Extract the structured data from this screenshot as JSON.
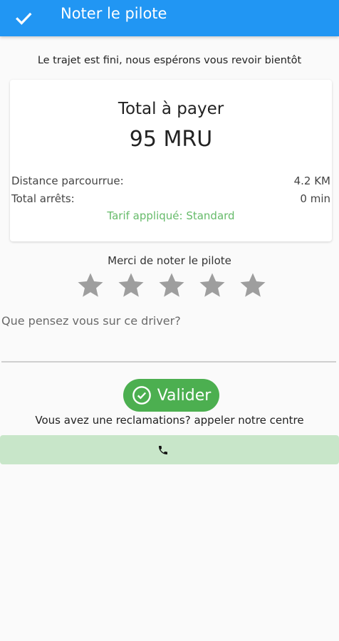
{
  "appbar": {
    "title": "Noter le pilote",
    "icon": "check-icon",
    "color": "#2196f3"
  },
  "trip": {
    "message": "Le trajet est fini, nous espérons vous revoir bientôt"
  },
  "summary": {
    "total_label": "Total à payer",
    "total_amount": "95 MRU",
    "distance_label": "Distance parcourrue:",
    "distance_value": "4.2 KM",
    "stops_label": "Total arrêts:",
    "stops_value": "0 min",
    "tarif": "Tarif appliqué: Standard",
    "tarif_color": "#66bb6a"
  },
  "rating": {
    "label": "Merci de noter le pilote",
    "stars_total": 5,
    "stars_selected": 0,
    "star_color": "#9e9e9e"
  },
  "feedback": {
    "placeholder": "Que pensez vous sur ce driver?",
    "value": ""
  },
  "actions": {
    "validate_label": "Valider",
    "validate_color": "#4caf50",
    "complaint_text": "Vous avez une reclamations? appeler notre centre",
    "call_icon": "phone-icon",
    "call_bar_color": "#c8e6c9"
  }
}
